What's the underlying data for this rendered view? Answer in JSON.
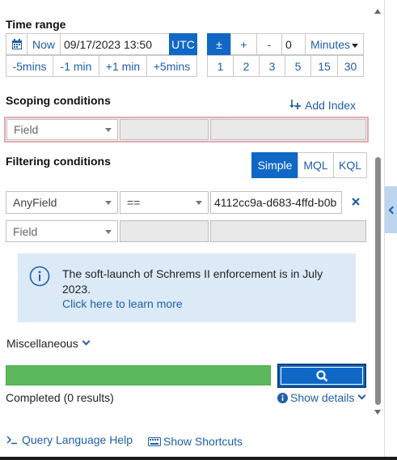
{
  "time_range": {
    "title": "Time range",
    "now_label": "Now",
    "datetime_value": "09/17/2023 13:50",
    "tz_label": "UTC",
    "plusminus_label": "±",
    "plus_label": "+",
    "minus_label": "-",
    "offset_value": "0",
    "unit_label": "Minutes",
    "quick_left": [
      "-5mins",
      "-1 min",
      "+1 min",
      "+5mins"
    ],
    "quick_right": [
      "1",
      "2",
      "3",
      "5",
      "15",
      "30"
    ]
  },
  "scoping": {
    "title": "Scoping conditions",
    "add_index_label": "Add Index",
    "field_placeholder": "Field"
  },
  "filtering": {
    "title": "Filtering conditions",
    "modes": [
      "Simple",
      "MQL",
      "KQL"
    ],
    "active_mode": "Simple",
    "row1": {
      "field": "AnyField",
      "operator": "==",
      "value": "4112cc9a-d683-4ffd-b0b"
    },
    "row2": {
      "field": "Field"
    }
  },
  "info": {
    "message": "The soft-launch of Schrems II enforcement is in July 2023.",
    "link_label": "Click here to learn more"
  },
  "misc_label": "Miscellaneous",
  "status": {
    "completed_text": "Completed (0 results)",
    "show_details_label": "Show details",
    "progress_fraction": 1.0
  },
  "footer": {
    "query_help_label": "Query Language Help",
    "shortcuts_label": "Show Shortcuts"
  },
  "colors": {
    "accent": "#1068c6",
    "progress": "#5cb85c",
    "info_bg": "#dceaf7",
    "scoping_border": "#e3a9b0"
  }
}
